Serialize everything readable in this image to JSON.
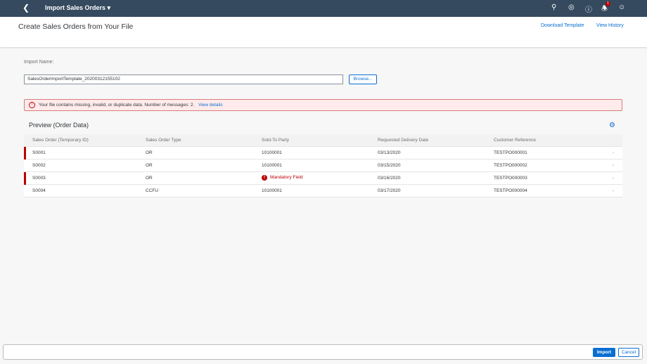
{
  "shell": {
    "title": "Import Sales Orders",
    "notification_count": "1"
  },
  "header": {
    "title": "Create Sales Orders from Your File",
    "download_template": "Download Template",
    "view_history": "View History"
  },
  "form": {
    "import_name_label": "Import Name:",
    "import_name_value": "SalesOrderImportTemplate_20200312155102",
    "browse_label": "Browse..."
  },
  "message": {
    "text": "Your file contains missing, invalid, or duplicate data. Number of messages: 2.",
    "link": "View details"
  },
  "preview": {
    "title": "Preview (Order Data)",
    "columns": [
      "Sales Order (Temporary ID)",
      "Sales Order Type",
      "Sold-To Party",
      "Requested Delivery Date",
      "Customer Reference"
    ],
    "rows": [
      {
        "id": "S0001",
        "type": "OR",
        "party": "10100001",
        "date": "03/13/2020",
        "ref": "TESTPO000001",
        "error": true
      },
      {
        "id": "S0002",
        "type": "OR",
        "party": "10100001",
        "date": "03/15/2020",
        "ref": "TESTPO000002",
        "error": false
      },
      {
        "id": "S0003",
        "type": "OR",
        "party": "Mandatory Field",
        "date": "03/16/2020",
        "ref": "TESTPO000003",
        "error": true
      },
      {
        "id": "S0004",
        "type": "CCFU",
        "party": "10100001",
        "date": "03/17/2020",
        "ref": "TESTPO000004",
        "error": false
      }
    ]
  },
  "footer": {
    "import_label": "Import",
    "cancel_label": "Cancel"
  }
}
